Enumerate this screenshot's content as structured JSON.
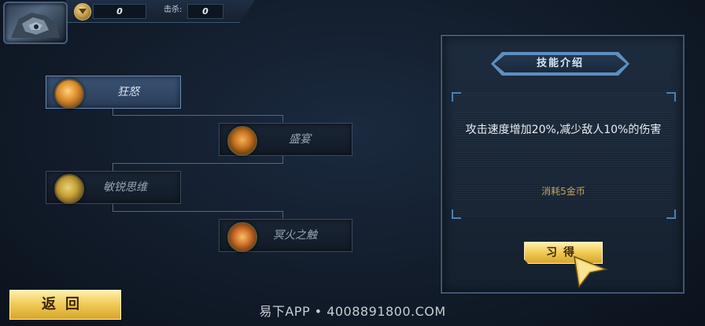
{
  "top_bar": {
    "coin_value": "0",
    "kill_label": "击杀:",
    "kill_value": "0"
  },
  "skills": [
    {
      "name": "狂怒",
      "state": "selected",
      "icon": "rage-fist-icon",
      "icon_color": "#d98a2b"
    },
    {
      "name": "盛宴",
      "state": "locked",
      "icon": "feast-claw-icon",
      "icon_color": "#c9751f"
    },
    {
      "name": "敏锐思维",
      "state": "locked",
      "icon": "keen-mind-icon",
      "icon_color": "#c9a43a"
    },
    {
      "name": "冥火之触",
      "state": "locked",
      "icon": "nether-fire-icon",
      "icon_color": "#d4742a"
    }
  ],
  "panel": {
    "title": "技能介绍",
    "description": "攻击速度增加20%,减少敌人10%的伤害",
    "cost": "消耗5金币",
    "learn_button": "习得"
  },
  "back_button": "返回",
  "watermark": "易下APP • 4008891800.COM",
  "colors": {
    "accent_gold": "#f1cd5a",
    "panel_border": "#3e5776",
    "cost_text": "#c3a45e"
  }
}
